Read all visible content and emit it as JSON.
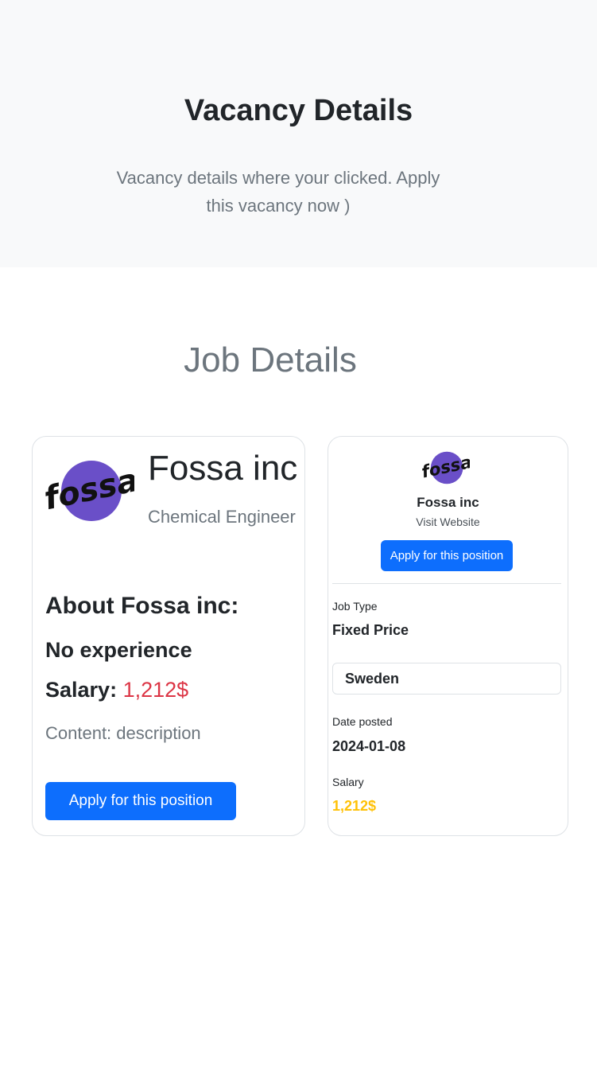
{
  "hero": {
    "title": "Vacancy Details",
    "subtitle": "Vacancy details where your clicked. Apply this vacancy now )"
  },
  "section": {
    "title": "Job Details"
  },
  "job_card": {
    "logo_icon": "fossa-logo",
    "company": "Fossa inc",
    "position": "Chemical Engineer",
    "about": "About Fossa inc:",
    "experience": "No experience",
    "salary_label": "Salary:",
    "salary_value": "1,212$",
    "content": "Content: description",
    "apply_label": "Apply for this position"
  },
  "sidebar_card": {
    "logo_icon": "fossa-logo",
    "company": "Fossa inc",
    "visit_label": "Visit Website",
    "apply_label": "Apply for this position",
    "job_type_label": "Job Type",
    "job_type_value": "Fixed Price",
    "country": "Sweden",
    "date_label": "Date posted",
    "date_value": "2024-01-08",
    "salary_label": "Salary",
    "salary_value": "1,212$"
  },
  "colors": {
    "primary": "#0d6efd",
    "danger": "#dc3545",
    "warning": "#ffc107",
    "logo_purple": "#6a4fc8"
  }
}
